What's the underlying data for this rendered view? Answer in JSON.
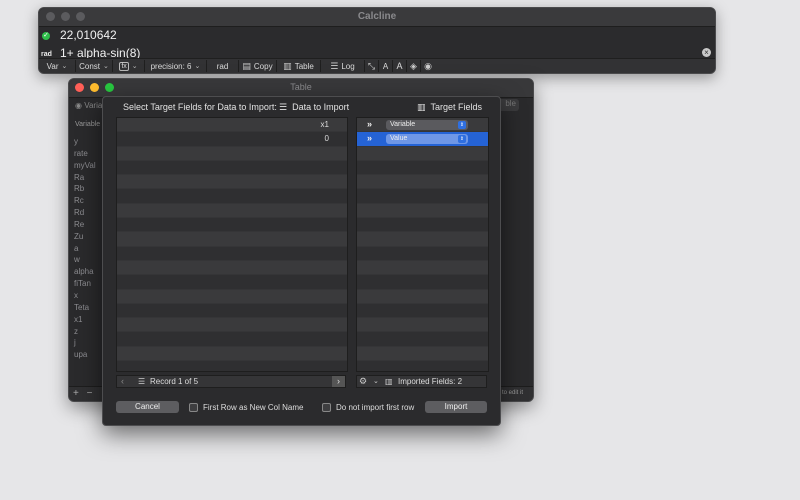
{
  "calcline": {
    "title": "Calcline",
    "result": "22,010642",
    "mode": "rad",
    "expression": "1+ alpha-sin(8)",
    "toolbar": {
      "var_label": "Var",
      "const_label": "Const",
      "fx_label": "fx",
      "precision_label": "precision: 6",
      "angle_label": "rad",
      "copy_label": "Copy",
      "table_label": "Table",
      "log_label": "Log",
      "font_smaller_label": "A",
      "font_larger_label": "A"
    }
  },
  "table_window": {
    "title": "Table",
    "radio_label": "Varia",
    "ghost_button_label": "ble",
    "column_header": "Variable",
    "variables": [
      "y",
      "rate",
      "myVal",
      "Ra",
      "Rb",
      "Rc",
      "Rd",
      "Re",
      "Zu",
      "a",
      "w",
      "alpha",
      "fiTan",
      "x",
      "Teta",
      "x1",
      "z",
      "j",
      "upa"
    ],
    "footer_hint": "to edit it",
    "footer_add": "+",
    "footer_remove": "−"
  },
  "import_sheet": {
    "header_label": "Select Target Fields for Data to Import:",
    "data_header": "Data to Import",
    "target_header": "Target Fields",
    "data_rows": [
      "x1",
      "0"
    ],
    "target_rows": [
      {
        "label": "Variable",
        "selected": false
      },
      {
        "label": "Value",
        "selected": true
      }
    ],
    "arrow_glyph": "»",
    "record_label": "Record 1 of 5",
    "imported_label": "Imported Fields: 2",
    "cancel_label": "Cancel",
    "first_row_label": "First Row as New Col Name",
    "no_import_label": "Do not import first row",
    "import_label": "Import"
  },
  "colors": {
    "accent": "#2563d5",
    "ok_green": "#2fbf4a",
    "close_red": "#ff5f57",
    "minimize_yellow": "#febc2e",
    "zoom_green": "#28c840"
  }
}
